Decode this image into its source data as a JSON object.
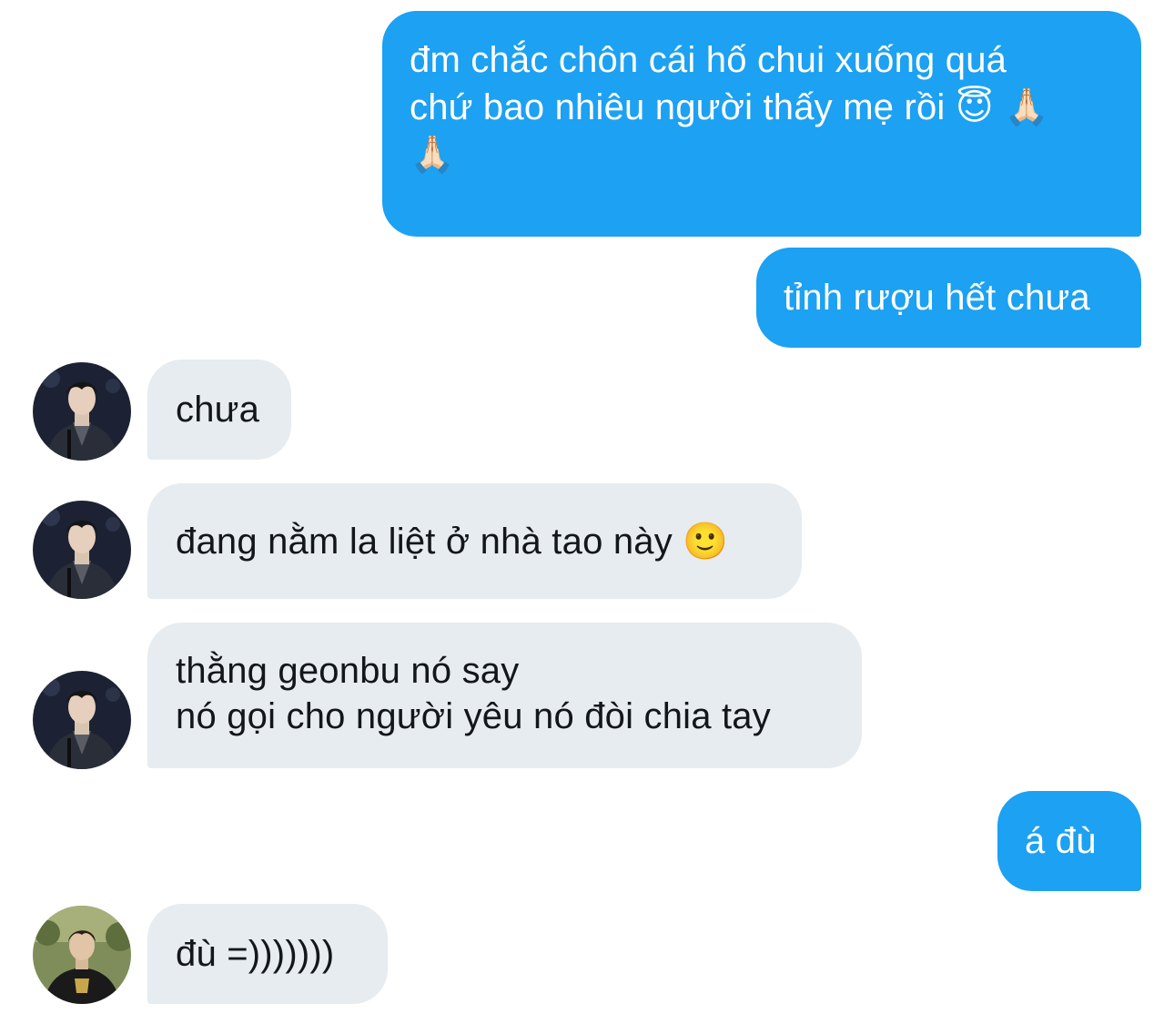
{
  "conversation": {
    "messages": [
      {
        "direction": "outgoing",
        "lines": [
          "đm chắc chôn cái hố chui xuống quá",
          "chứ bao nhiêu người thấy mẹ rồi 😇 🙏🏻",
          "🙏🏻"
        ]
      },
      {
        "direction": "outgoing",
        "lines": [
          "tỉnh rượu hết chưa"
        ]
      },
      {
        "direction": "incoming",
        "avatar": "avatar-man-in-dark-coat",
        "lines": [
          "chưa"
        ]
      },
      {
        "direction": "incoming",
        "avatar": "avatar-man-in-dark-coat",
        "lines": [
          "đang nằm la liệt ở nhà tao này 🙂"
        ]
      },
      {
        "direction": "incoming",
        "avatar": "avatar-man-in-dark-coat",
        "lines": [
          "thằng geonbu nó say",
          "nó gọi cho người yêu nó đòi chia tay"
        ]
      },
      {
        "direction": "outgoing",
        "lines": [
          "á đù"
        ]
      },
      {
        "direction": "incoming",
        "avatar": "avatar-man-in-jersey",
        "lines": [
          "đù =)))))))"
        ]
      }
    ]
  },
  "colors": {
    "outgoing_bubble": "#1da1f2",
    "incoming_bubble": "#e6ecf0",
    "outgoing_text": "#ffffff",
    "incoming_text": "#14171a"
  }
}
